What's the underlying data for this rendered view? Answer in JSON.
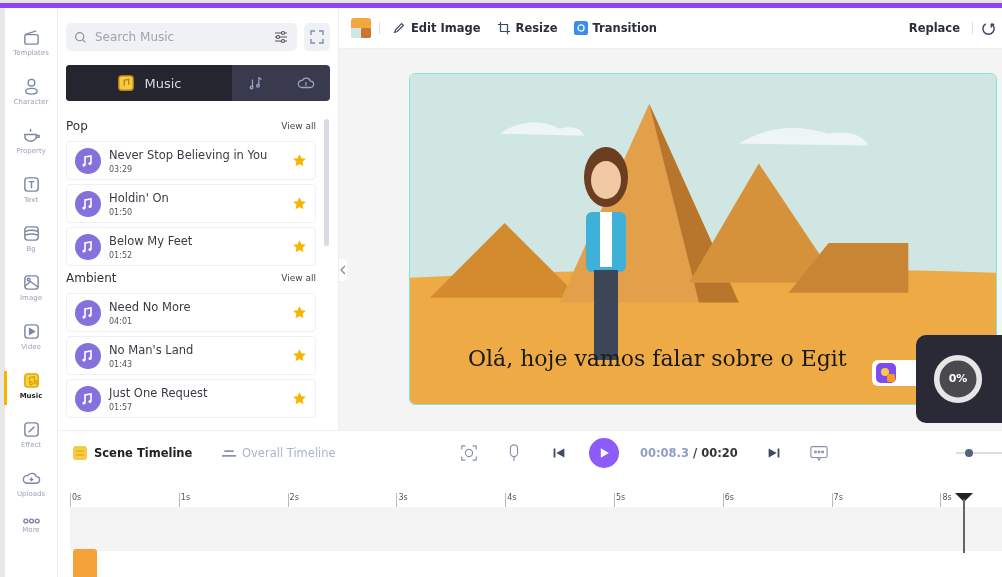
{
  "rail": [
    {
      "kind": "templates",
      "label": "Templates",
      "selected": false
    },
    {
      "kind": "character",
      "label": "Character",
      "selected": false
    },
    {
      "kind": "property",
      "label": "Property",
      "selected": false
    },
    {
      "kind": "text",
      "label": "Text",
      "selected": false
    },
    {
      "kind": "bg",
      "label": "Bg",
      "selected": false
    },
    {
      "kind": "image",
      "label": "Image",
      "selected": false
    },
    {
      "kind": "video",
      "label": "Video",
      "selected": false
    },
    {
      "kind": "music",
      "label": "Music",
      "selected": true
    },
    {
      "kind": "effect",
      "label": "Effect",
      "selected": false
    },
    {
      "kind": "uploads",
      "label": "Uploads",
      "selected": false
    },
    {
      "kind": "more",
      "label": "More",
      "selected": false
    }
  ],
  "search": {
    "placeholder": "Search Music"
  },
  "panel_tabs": [
    {
      "kind": "music",
      "label": "Music",
      "selected": true
    },
    {
      "kind": "notes",
      "selected": false
    },
    {
      "kind": "cloud",
      "selected": false
    }
  ],
  "sections": [
    {
      "title": "Pop",
      "link": "View all",
      "tracks": [
        {
          "name": "Never Stop Believing in You",
          "duration": "03:29",
          "starred": true
        },
        {
          "name": "Holdin' On",
          "duration": "01:50",
          "starred": true
        },
        {
          "name": "Below My Feet",
          "duration": "01:52",
          "starred": true
        }
      ]
    },
    {
      "title": "Ambient",
      "link": "View all",
      "tracks": [
        {
          "name": "Need No More",
          "duration": "04:01",
          "starred": true
        },
        {
          "name": "No Man's Land",
          "duration": "01:43",
          "starred": true
        },
        {
          "name": "Just One Request",
          "duration": "01:57",
          "starred": true
        }
      ]
    }
  ],
  "toolbar": {
    "items": [
      {
        "kind": "edit",
        "label": "Edit Image"
      },
      {
        "kind": "resize",
        "label": "Resize"
      },
      {
        "kind": "transition",
        "label": "Transition"
      }
    ],
    "replace": "Replace"
  },
  "canvas": {
    "subtitle": "Olá, hoje vamos falar sobre o Egit"
  },
  "export": {
    "percent": "0%",
    "level": 0
  },
  "zoom": {
    "level": 0.15
  },
  "timeline": {
    "tabs": [
      {
        "label": "Scene Timeline",
        "selected": true
      },
      {
        "label": "Overall Timeline",
        "selected": false
      }
    ],
    "current": "00:08.3",
    "separator": "/",
    "total": "00:20",
    "ticks": [
      "0s",
      "1s",
      "2s",
      "3s",
      "4s",
      "5s",
      "6s",
      "7s",
      "8s"
    ]
  }
}
